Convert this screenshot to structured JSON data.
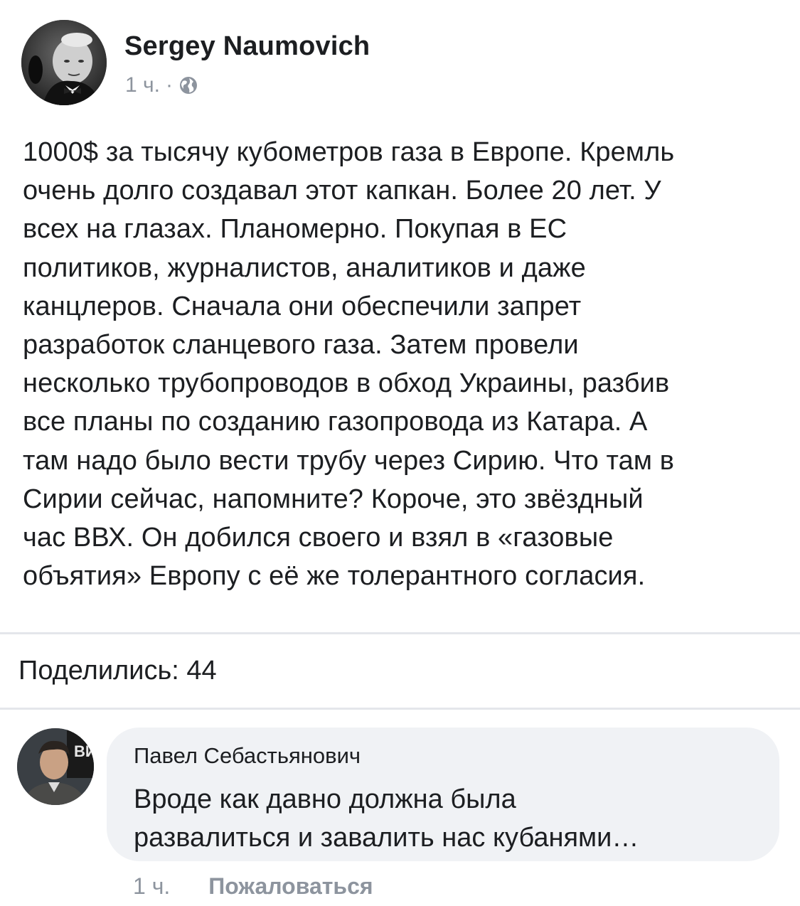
{
  "post": {
    "author": "Sergey Naumovich",
    "time": "1 ч.",
    "separator": "·",
    "privacy_icon": "globe-icon",
    "avatar_icon": "profile-photo",
    "text": "1000$ за тысячу кубометров газа в Европе. Кремль\nочень долго создавал этот капкан. Более 20 лет. У\nвсех на глазах. Планомерно. Покупая в ЕС\nполитиков, журналистов, аналитиков и даже\nканцлеров. Сначала они обеспечили запрет\nразработок сланцевого газа. Затем провели\nнесколько трубопроводов в обход Украины, разбив\nвсе планы по созданию газопровода из Катара. А\nтам надо было вести трубу через Сирию. Что там в\nСирии сейчас, напомните? Короче, это звёздный\nчас ВВХ. Он добился своего и взял в «газовые\nобъятия» Европу с её же толерантного согласия."
  },
  "shares": {
    "label": "Поделились: 44"
  },
  "comment": {
    "author": "Павел Себастьянович",
    "text": "Вроде как давно должна была\nразвалиться и завалить нас кубанями…",
    "time": "1 ч.",
    "report_label": "Пожаловаться",
    "avatar_icon": "profile-photo"
  },
  "colors": {
    "text": "#1c1e21",
    "secondary": "#8d949e",
    "bubble": "#f0f2f5",
    "divider": "#e4e6eb"
  }
}
